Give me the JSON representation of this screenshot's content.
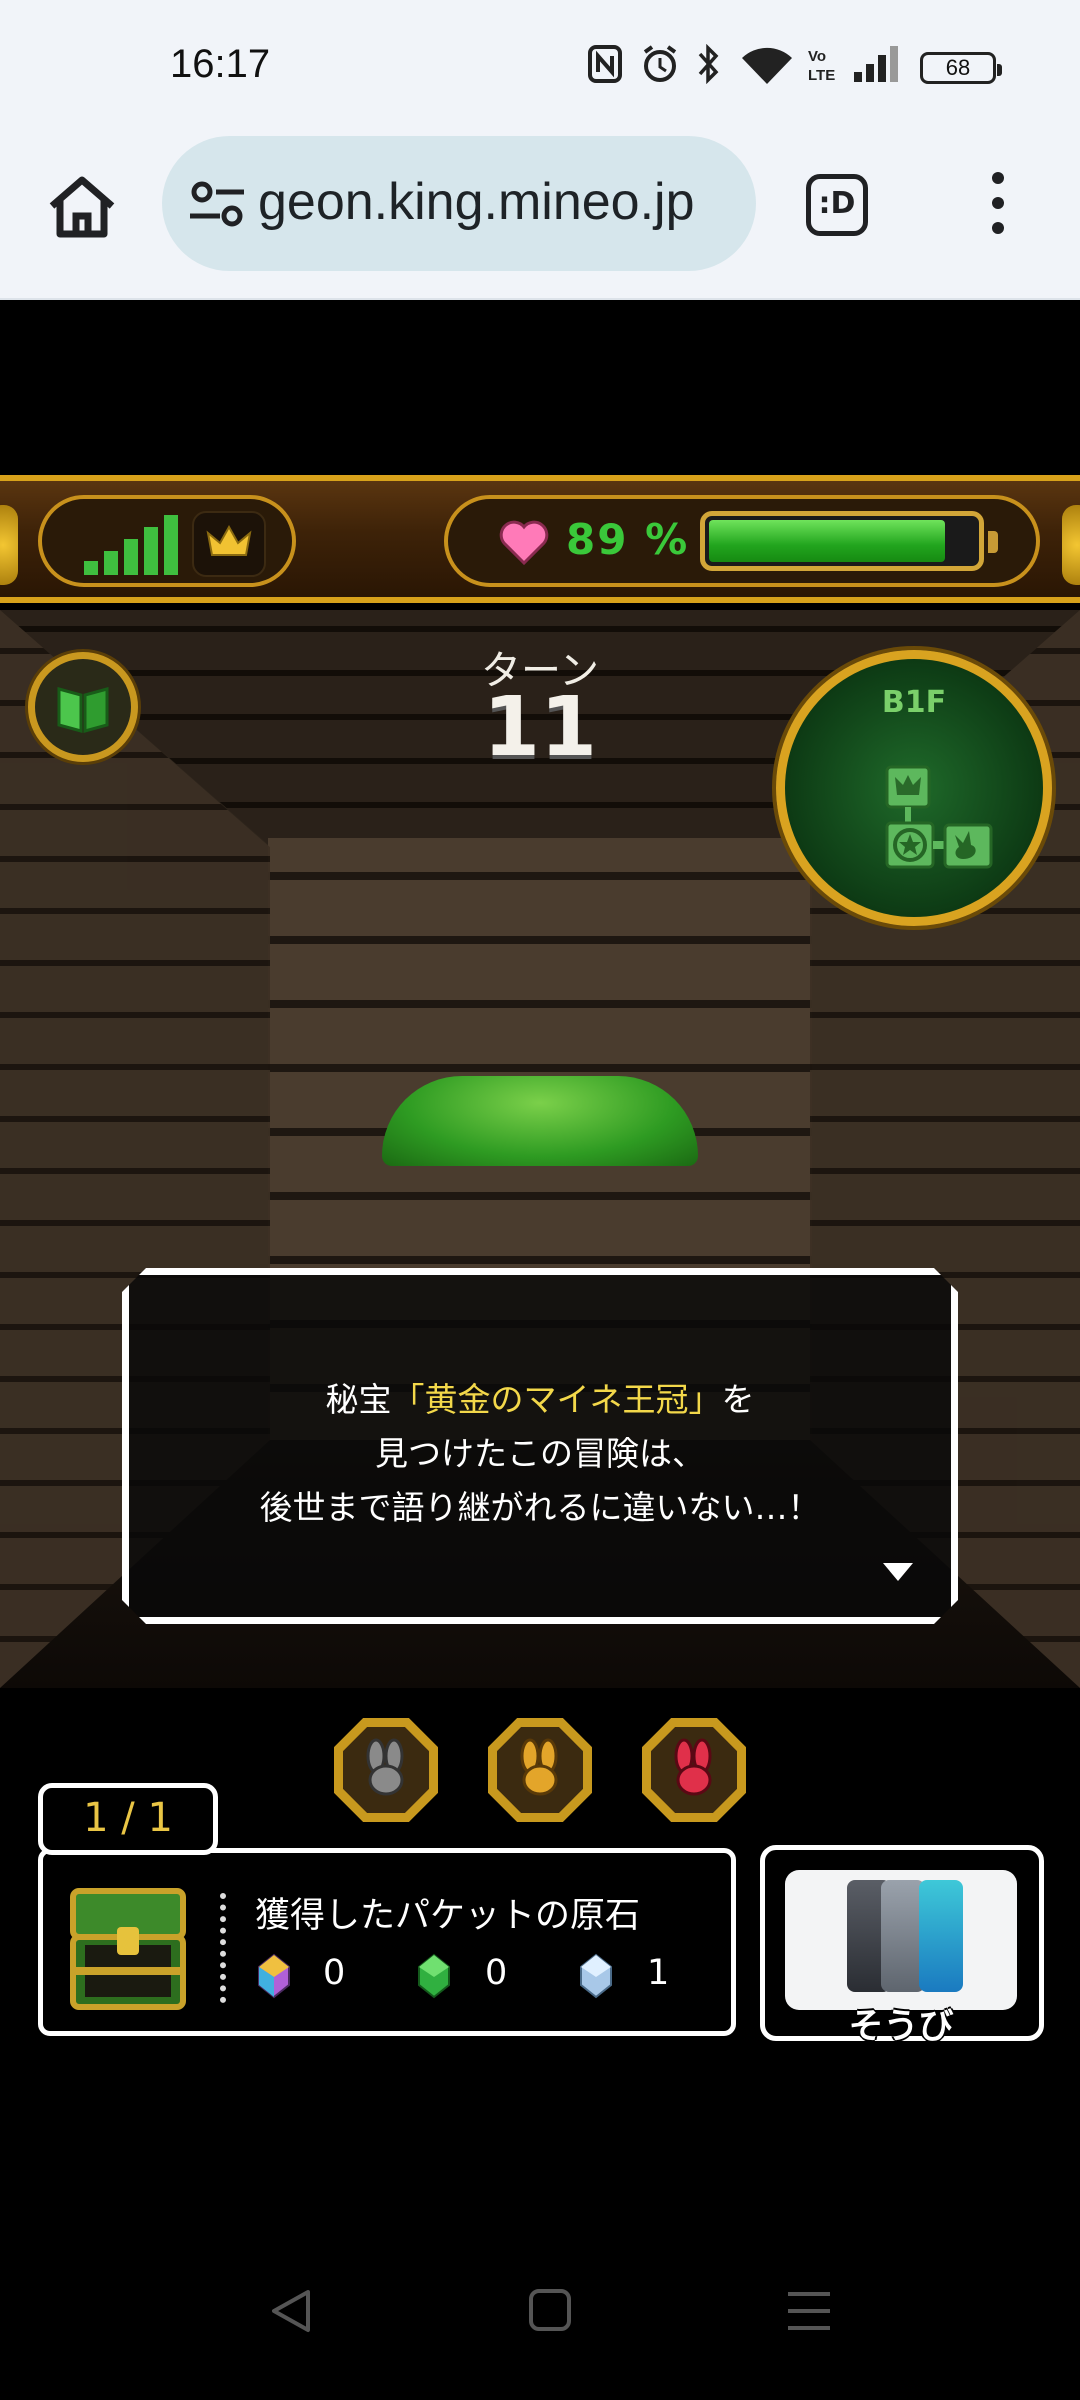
{
  "status_bar": {
    "time": "16:17",
    "icons": [
      "nfc-icon",
      "alarm-icon",
      "bluetooth-icon",
      "wifi-icon",
      "volte-icon",
      "signal-icon"
    ],
    "volte": "Vo LTE",
    "battery": "68"
  },
  "browser": {
    "url": "geon.king.mineo.jp",
    "tab_button_label": ":D"
  },
  "game": {
    "hp_text": "89 %",
    "hp_percent": 89,
    "turn_label": "ターン",
    "turn_value": "11",
    "floor": "B1F",
    "message": {
      "line1_prefix": "秘宝",
      "line1_highlight": "「黄金のマイネ王冠」",
      "line1_suffix": "を",
      "line2": "見つけたこの冒険は、",
      "line3": "後世まで語り継がれるに違いない…！"
    },
    "counter": "1 / 1",
    "stones_title": "獲得したパケットの原石",
    "stones": [
      {
        "name": "rainbow-stone",
        "count": "0",
        "color": "#b060d8"
      },
      {
        "name": "green-stone",
        "count": "0",
        "color": "#30b040"
      },
      {
        "name": "blue-stone",
        "count": "1",
        "color": "#a8c8e8"
      }
    ],
    "equip_label": "そうび",
    "colors": {
      "gold": "#d8a21b",
      "hp_green": "#3ac83a",
      "highlight": "#f3d84a"
    }
  }
}
